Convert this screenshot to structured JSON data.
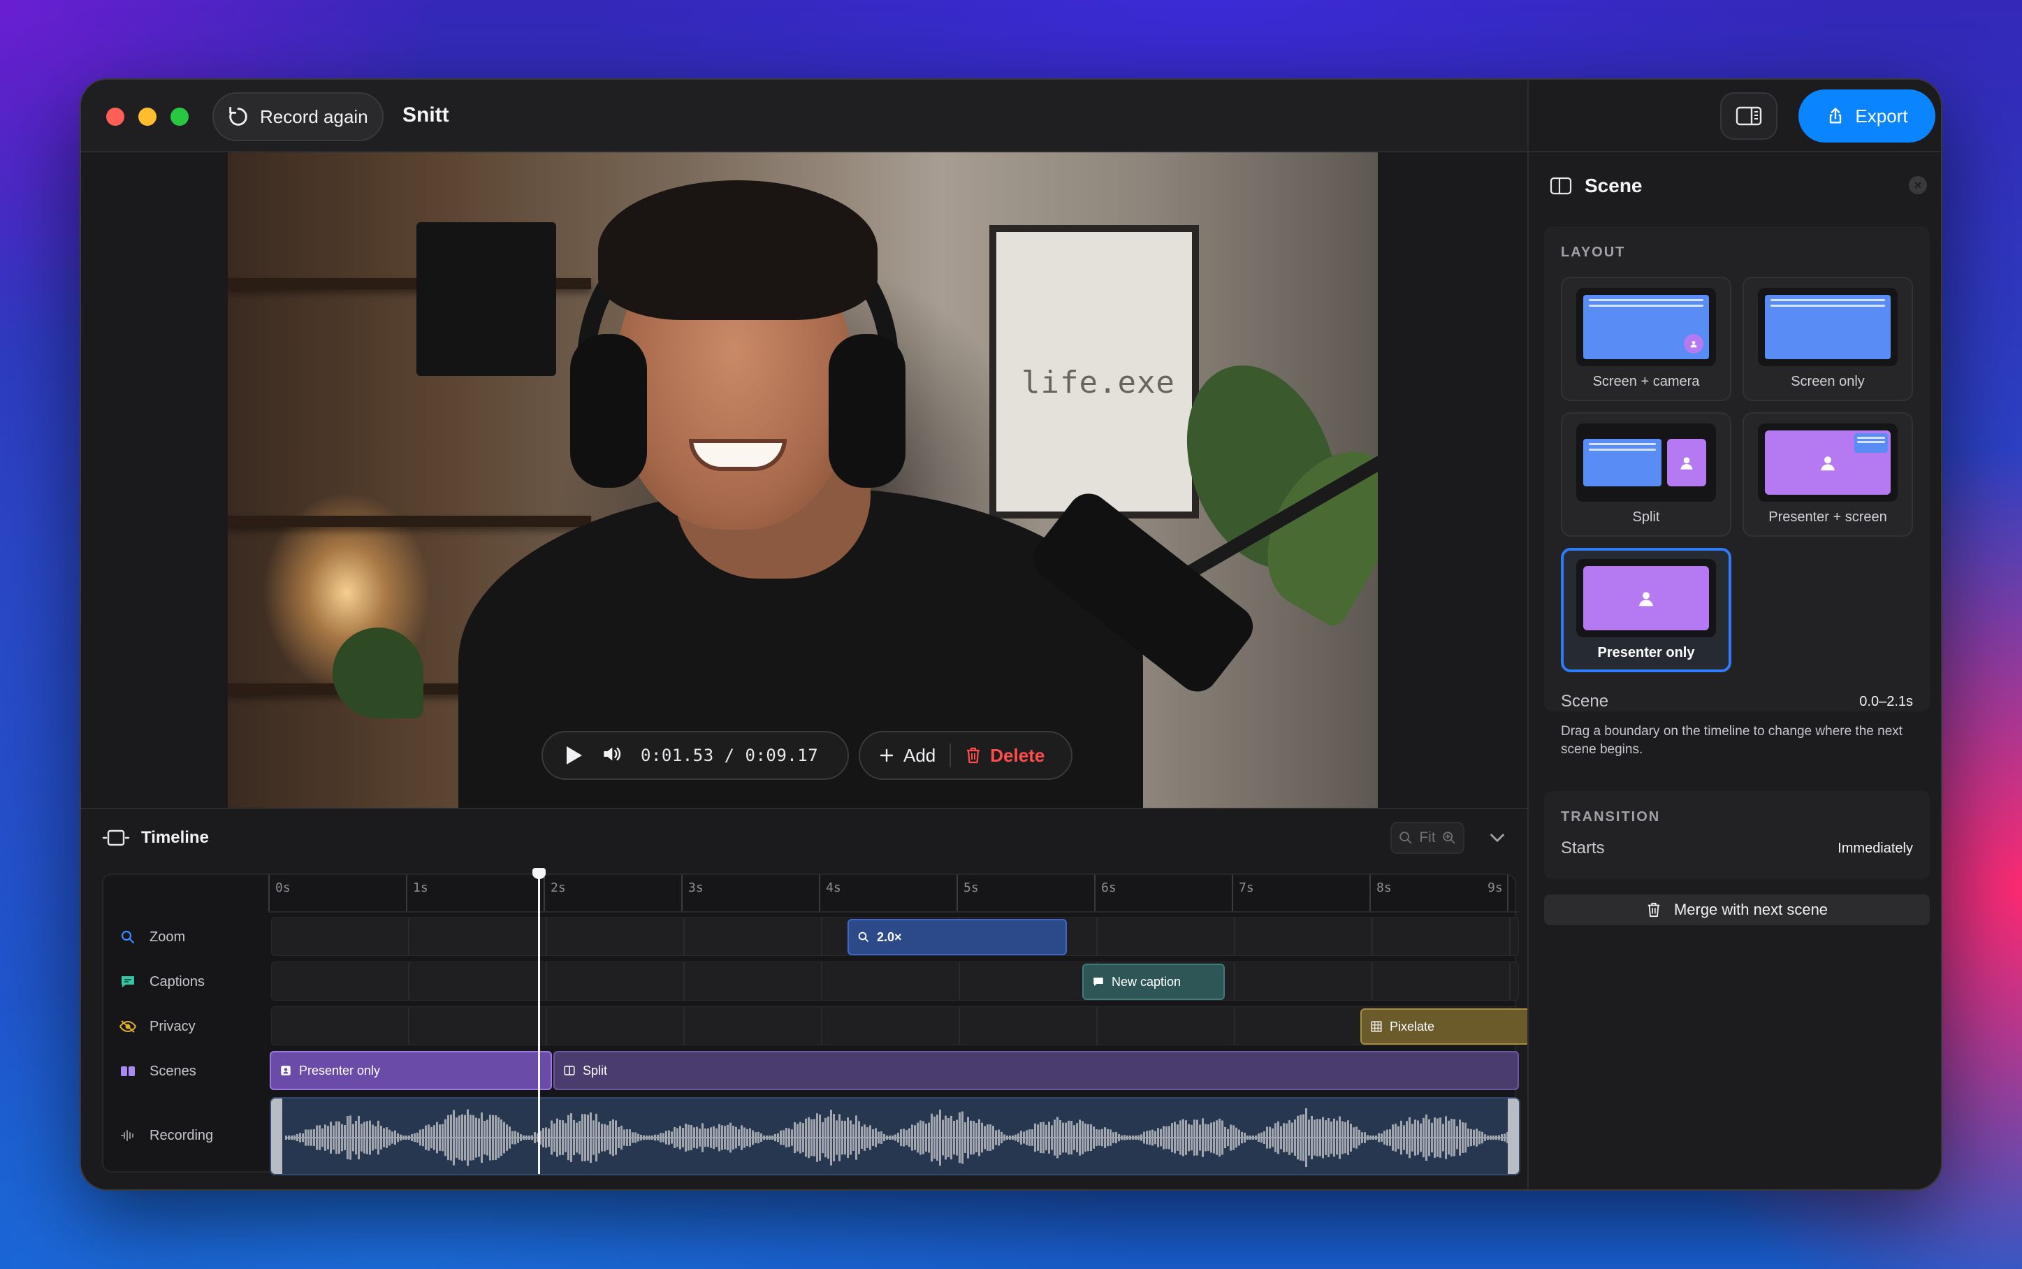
{
  "window": {
    "title": "Snitt",
    "record_again_label": "Record again"
  },
  "player": {
    "timecode": "0:01.53 / 0:09.17",
    "add_label": "Add",
    "delete_label": "Delete",
    "playback_position": 0.167
  },
  "preview": {
    "poster_text": "life.exe"
  },
  "timeline": {
    "title": "Timeline",
    "fit_label": "Fit",
    "ruler_ticks": [
      "0s",
      "1s",
      "2s",
      "3s",
      "4s",
      "5s",
      "6s",
      "7s",
      "8s",
      "9s"
    ],
    "tracks": [
      {
        "label": "Zoom",
        "icon": "zoom-icon"
      },
      {
        "label": "Captions",
        "icon": "caption-icon"
      },
      {
        "label": "Privacy",
        "icon": "privacy-eye-icon"
      },
      {
        "label": "Scenes",
        "icon": "scenes-icon"
      },
      {
        "label": "Recording",
        "icon": "waveform-icon"
      }
    ],
    "zoom_clip_label": "2.0×",
    "caption_clip_label": "New caption",
    "privacy_clip_label": "Pixelate",
    "scene_clips": [
      "Presenter only",
      "Split"
    ]
  },
  "sidebar": {
    "export_label": "Export",
    "panel_title": "Scene",
    "layout_heading": "LAYOUT",
    "layouts": [
      {
        "label": "Screen + camera",
        "selected": false
      },
      {
        "label": "Screen only",
        "selected": false
      },
      {
        "label": "Split",
        "selected": false
      },
      {
        "label": "Presenter + screen",
        "selected": false
      },
      {
        "label": "Presenter only",
        "selected": true
      }
    ],
    "scene_key": "Scene",
    "scene_value": "0.0–2.1s",
    "scene_hint": "Drag a boundary on the timeline to change where the next scene begins.",
    "transition_heading": "TRANSITION",
    "starts_key": "Starts",
    "starts_value": "Immediately",
    "merge_label": "Merge with next scene"
  },
  "colors": {
    "accent": "#0a84ff",
    "danger": "#ff4d4d",
    "screen_blue": "#5a8cf5",
    "camera_purple": "#b57af2"
  }
}
